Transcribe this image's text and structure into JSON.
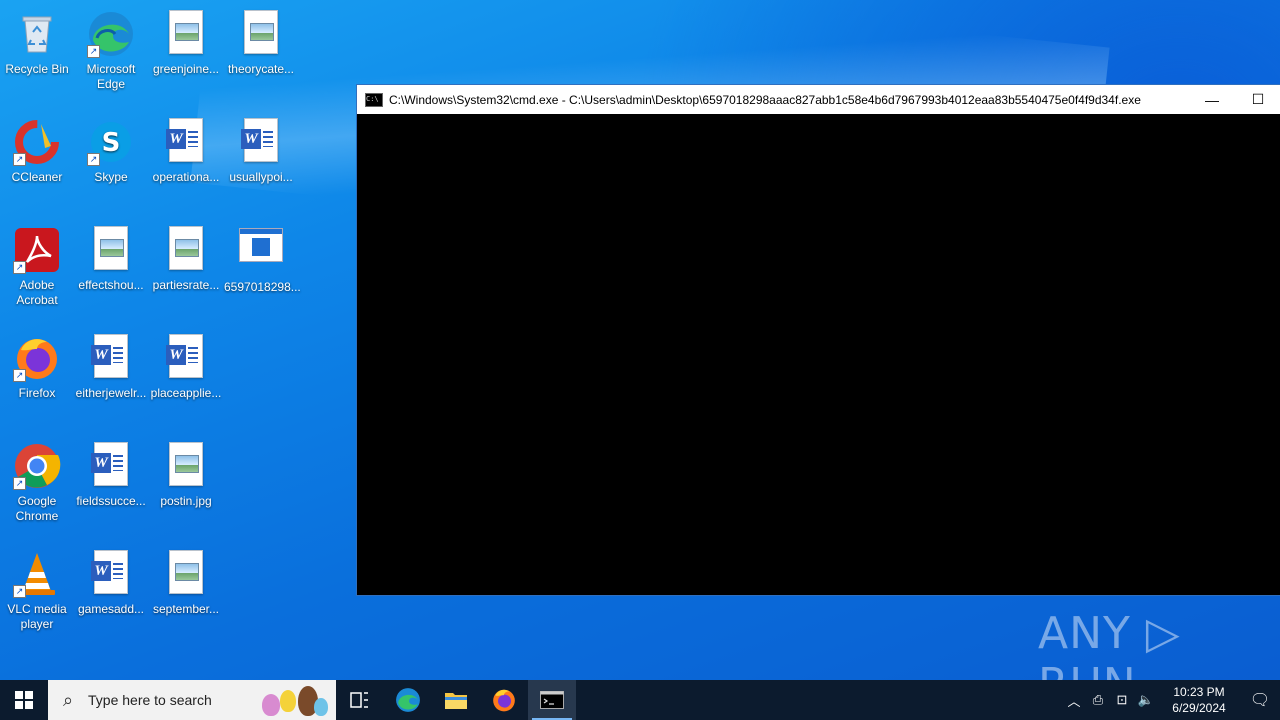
{
  "desktop": {
    "icons": [
      {
        "label": "Recycle Bin",
        "type": "recycle-bin"
      },
      {
        "label": "Microsoft Edge",
        "type": "edge"
      },
      {
        "label": "greenjoine...",
        "type": "image"
      },
      {
        "label": "theorycate...",
        "type": "image"
      },
      {
        "label": "CCleaner",
        "type": "ccleaner"
      },
      {
        "label": "Skype",
        "type": "skype"
      },
      {
        "label": "operationa...",
        "type": "word"
      },
      {
        "label": "usuallypoi...",
        "type": "word"
      },
      {
        "label": "Adobe Acrobat",
        "type": "acrobat"
      },
      {
        "label": "effectshou...",
        "type": "image"
      },
      {
        "label": "partiesrate...",
        "type": "image"
      },
      {
        "label": "6597018298...",
        "type": "exe"
      },
      {
        "label": "Firefox",
        "type": "firefox"
      },
      {
        "label": "eitherjewelr...",
        "type": "word"
      },
      {
        "label": "placeapplie...",
        "type": "word"
      },
      {
        "label": "Google Chrome",
        "type": "chrome"
      },
      {
        "label": "fieldssucce...",
        "type": "word"
      },
      {
        "label": "postin.jpg",
        "type": "image"
      },
      {
        "label": "VLC media player",
        "type": "vlc"
      },
      {
        "label": "gamesadd...",
        "type": "word"
      },
      {
        "label": "september...",
        "type": "image"
      }
    ]
  },
  "cmd_window": {
    "title": "C:\\Windows\\System32\\cmd.exe - C:\\Users\\admin\\Desktop\\6597018298aaac827abb1c58e4b6d7967993b4012eaa83b5540475e0f4f9d34f.exe",
    "icon": "cmd-icon",
    "minimize_glyph": "—",
    "maximize_glyph": "☐"
  },
  "watermark": {
    "text": "ANY ▷ RUN"
  },
  "taskbar": {
    "start_icon": "windows-logo-icon",
    "search_placeholder": "Type here to search",
    "pinned": [
      "task-view",
      "edge",
      "file-explorer",
      "firefox",
      "cmd"
    ],
    "clock_time": "10:23 PM",
    "clock_date": "6/29/2024"
  },
  "colors": {
    "taskbar": "#0c1b2e",
    "desktop": "#0e86e8",
    "titlebar": "#ffffff"
  }
}
